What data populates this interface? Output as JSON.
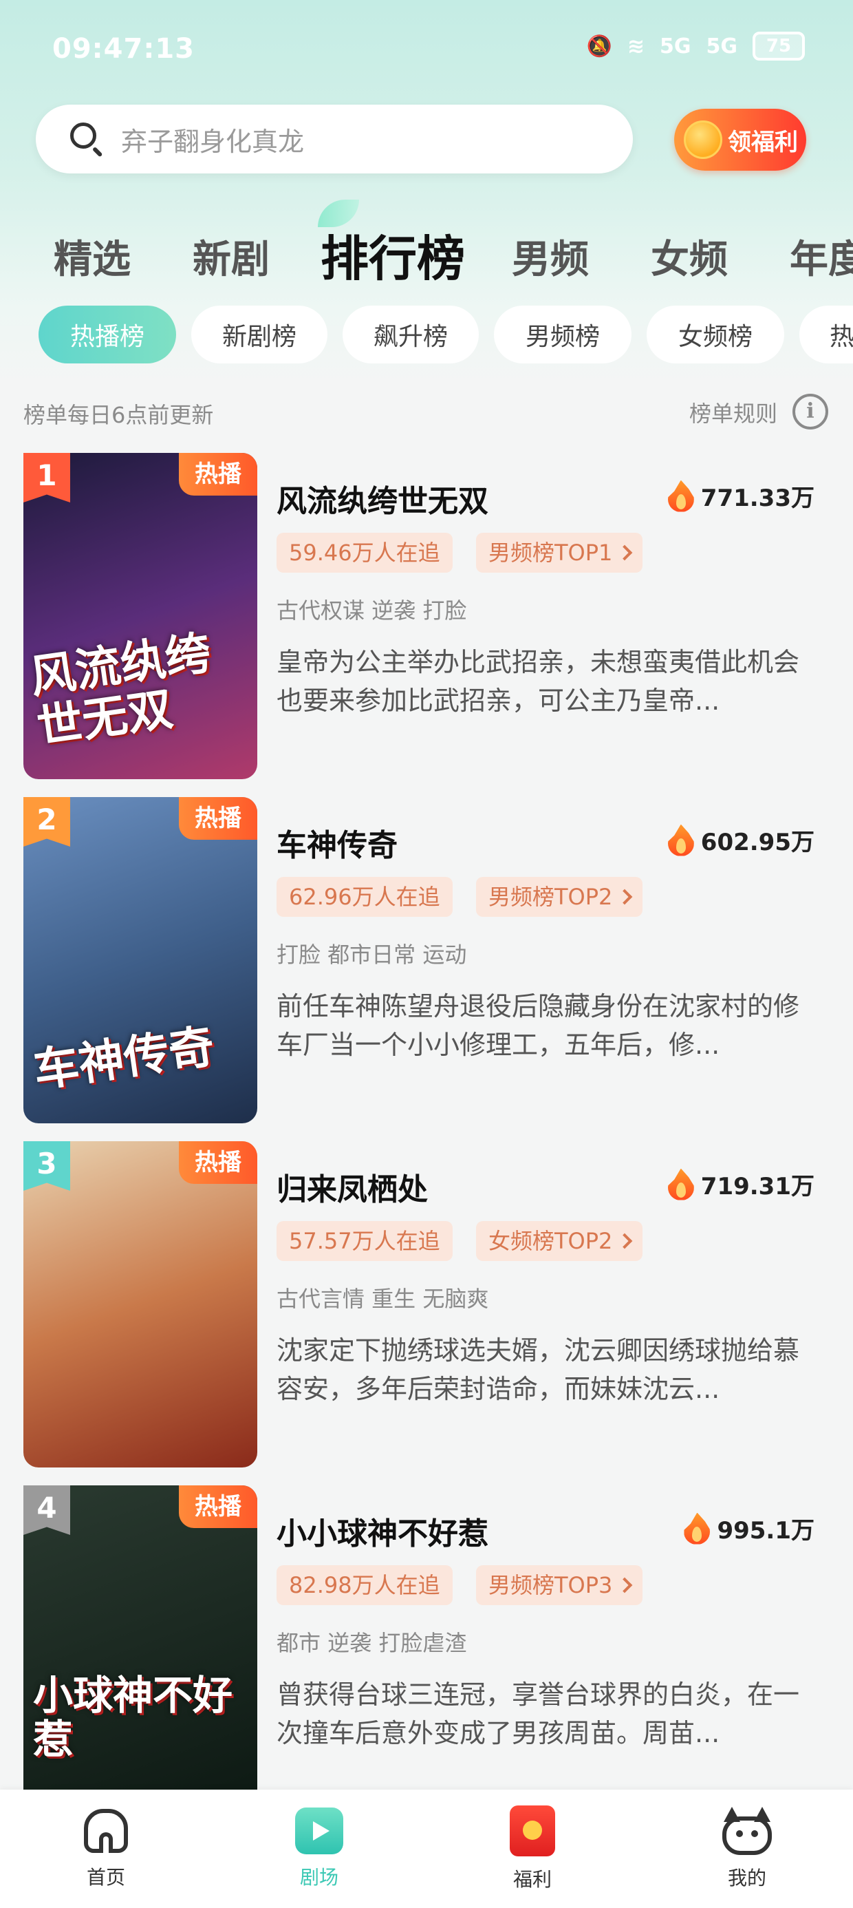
{
  "status_bar": {
    "time": "09:47:13",
    "battery": "75",
    "signal_1": "5G",
    "signal_2": "5G"
  },
  "search": {
    "placeholder": "弃子翻身化真龙"
  },
  "welfare_button": {
    "label": "领福利"
  },
  "top_tabs": [
    {
      "label": "精选"
    },
    {
      "label": "新剧"
    },
    {
      "label": "排行榜",
      "active": true
    },
    {
      "label": "男频"
    },
    {
      "label": "女频"
    },
    {
      "label": "年度"
    }
  ],
  "rank_chips": [
    {
      "label": "热播榜",
      "active": true
    },
    {
      "label": "新剧榜"
    },
    {
      "label": "飙升榜"
    },
    {
      "label": "男频榜"
    },
    {
      "label": "女频榜"
    },
    {
      "label": "热"
    }
  ],
  "info": {
    "update_note": "榜单每日6点前更新",
    "rules_label": "榜单规则",
    "rules_icon": "i"
  },
  "items": [
    {
      "rank": "1",
      "rank_color": "#ff5a3a",
      "hot_label": "热播",
      "title": "风流纨绔世无双",
      "heat": "771.33万",
      "followers": "59.46万人在追",
      "rank_badge": "男频榜TOP1",
      "tags": "古代权谋 逆袭 打脸",
      "description": "皇帝为公主举办比武招亲，未想蛮夷借此机会也要来参加比武招亲，可公主乃皇帝...",
      "poster_text": "风流纨绔世无双",
      "poster_colors": [
        "#1c1a3a",
        "#5a2d7a",
        "#b03a6a"
      ]
    },
    {
      "rank": "2",
      "rank_color": "#ff9a3a",
      "hot_label": "热播",
      "title": "车神传奇",
      "heat": "602.95万",
      "followers": "62.96万人在追",
      "rank_badge": "男频榜TOP2",
      "tags": "打脸 都市日常 运动",
      "description": "前任车神陈望舟退役后隐藏身份在沈家村的修车厂当一个小小修理工，五年后，修...",
      "poster_text": "车神传奇",
      "poster_colors": [
        "#6a8fc0",
        "#3f5f8a",
        "#1e2e4a"
      ]
    },
    {
      "rank": "3",
      "rank_color": "#5fd5cc",
      "hot_label": "热播",
      "title": "归来凤栖处",
      "heat": "719.31万",
      "followers": "57.57万人在追",
      "rank_badge": "女频榜TOP2",
      "tags": "古代言情 重生 无脑爽",
      "description": "沈家定下抛绣球选夫婿，沈云卿因绣球抛给慕容安，多年后荣封诰命，而妹妹沈云...",
      "poster_text": "",
      "poster_colors": [
        "#e9d2b0",
        "#c9794a",
        "#8a2a1a"
      ]
    },
    {
      "rank": "4",
      "rank_color": "#9a9a9a",
      "hot_label": "热播",
      "title": "小小球神不好惹",
      "heat": "995.1万",
      "followers": "82.98万人在追",
      "rank_badge": "男频榜TOP3",
      "tags": "都市 逆袭 打脸虐渣",
      "description": "曾获得台球三连冠，享誉台球界的白炎，在一次撞车后意外变成了男孩周苗。周苗...",
      "poster_text": "小球神不好惹",
      "poster_colors": [
        "#2a3a30",
        "#1c2a22",
        "#0e1a14"
      ]
    }
  ],
  "bottom_nav": [
    {
      "label": "首页",
      "icon": "home-icon"
    },
    {
      "label": "剧场",
      "icon": "play-icon",
      "active": true
    },
    {
      "label": "福利",
      "icon": "red-envelope-icon"
    },
    {
      "label": "我的",
      "icon": "cat-icon"
    }
  ],
  "colors": {
    "accent": "#3cc8b4",
    "hot": "#ff5a2a",
    "badge_bg": "#fbe6dc",
    "badge_text": "#d8774f"
  }
}
